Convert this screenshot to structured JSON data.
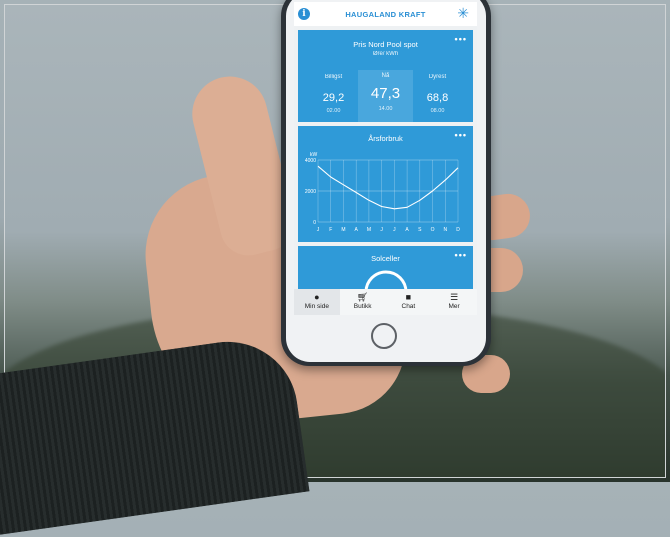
{
  "app": {
    "brand": "HAUGALAND KRAFT",
    "info_icon": "info-icon",
    "logo_icon": "snowflake-logo-icon"
  },
  "price_card": {
    "title": "Pris Nord Pool spot",
    "unit": "Øre/ kWh",
    "menu": "•••",
    "columns": [
      {
        "label": "Billigst",
        "value": "29,2",
        "time": "02.00"
      },
      {
        "label": "Nå",
        "value": "47,3",
        "time": "14.00"
      },
      {
        "label": "Dyrest",
        "value": "68,8",
        "time": "08.00"
      }
    ]
  },
  "usage_card": {
    "title": "Årsforbruk",
    "menu": "•••"
  },
  "solar_card": {
    "title": "Solceller",
    "menu": "•••"
  },
  "chart_data": {
    "type": "line",
    "title": "Årsforbruk",
    "ylabel": "kW",
    "categories": [
      "J",
      "F",
      "M",
      "A",
      "M",
      "J",
      "J",
      "A",
      "S",
      "O",
      "N",
      "D"
    ],
    "y_ticks": [
      "4000",
      "2000",
      "0"
    ],
    "ylim": [
      0,
      4000
    ],
    "values": [
      3600,
      2900,
      2400,
      1900,
      1400,
      1000,
      850,
      950,
      1400,
      2000,
      2700,
      3500
    ],
    "grid": true
  },
  "nav": {
    "items": [
      {
        "label": "Min side",
        "icon": "person-icon"
      },
      {
        "label": "Butikk",
        "icon": "cart-icon"
      },
      {
        "label": "Chat",
        "icon": "chat-icon"
      },
      {
        "label": "Mer",
        "icon": "menu-icon"
      }
    ]
  }
}
